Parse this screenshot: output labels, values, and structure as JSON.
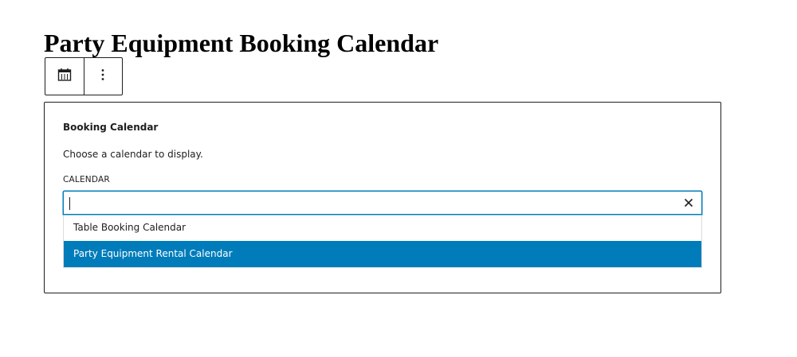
{
  "page": {
    "title": "Party Equipment Booking Calendar"
  },
  "toolbar": {
    "block_icon": "calendar-icon",
    "more_icon": "more-vertical-icon",
    "more_glyph": "⋮"
  },
  "block": {
    "title": "Booking Calendar",
    "instructions": "Choose a calendar to display.",
    "field_label": "CALENDAR",
    "input_value": "",
    "clear_icon": "close-icon",
    "options": [
      {
        "label": "Table Booking Calendar",
        "selected": false
      },
      {
        "label": "Party Equipment Rental Calendar",
        "selected": true
      }
    ]
  },
  "colors": {
    "accent": "#007cba",
    "text": "#1e1e1e",
    "border": "#1e1e1e",
    "background": "#ffffff"
  }
}
